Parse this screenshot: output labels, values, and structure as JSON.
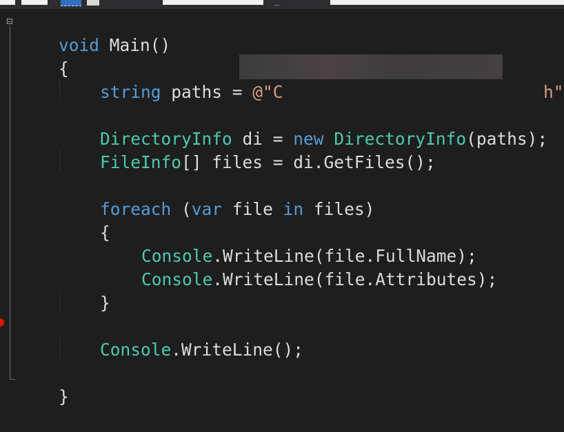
{
  "toolbar": {
    "fragment": "_"
  },
  "code": {
    "line1": {
      "kw": "void",
      "rest": " Main()"
    },
    "line2": {
      "text": "{"
    },
    "line3": {
      "kw": "string",
      "rest": " paths = ",
      "str_open": "@\"C",
      "str_close": "h\"",
      "semi": ";"
    },
    "line5": {
      "type1": "DirectoryInfo",
      "mid1": " di = ",
      "kw": "new",
      "sp": " ",
      "type2": "DirectoryInfo",
      "rest": "(paths);"
    },
    "line6": {
      "type": "FileInfo",
      "rest": "[] files = di.GetFiles();"
    },
    "line8": {
      "kw1": "foreach",
      "p1": " (",
      "kw2": "var",
      "p2": " file ",
      "kw3": "in",
      "p3": " files)"
    },
    "line9": {
      "text": "{"
    },
    "line10": {
      "type": "Console",
      "rest": ".WriteLine(file.FullName);"
    },
    "line11": {
      "type": "Console",
      "rest": ".WriteLine(file.Attributes);"
    },
    "line12": {
      "text": "}"
    },
    "line14": {
      "type": "Console",
      "rest": ".WriteLine();"
    },
    "line16": {
      "text": "}"
    }
  },
  "colors": {
    "background": "#1e1e1e",
    "keyword": "#569cd6",
    "type": "#4ec9b0",
    "string": "#d69d85",
    "text": "#dcdcdc",
    "breakpoint": "#e51400"
  }
}
